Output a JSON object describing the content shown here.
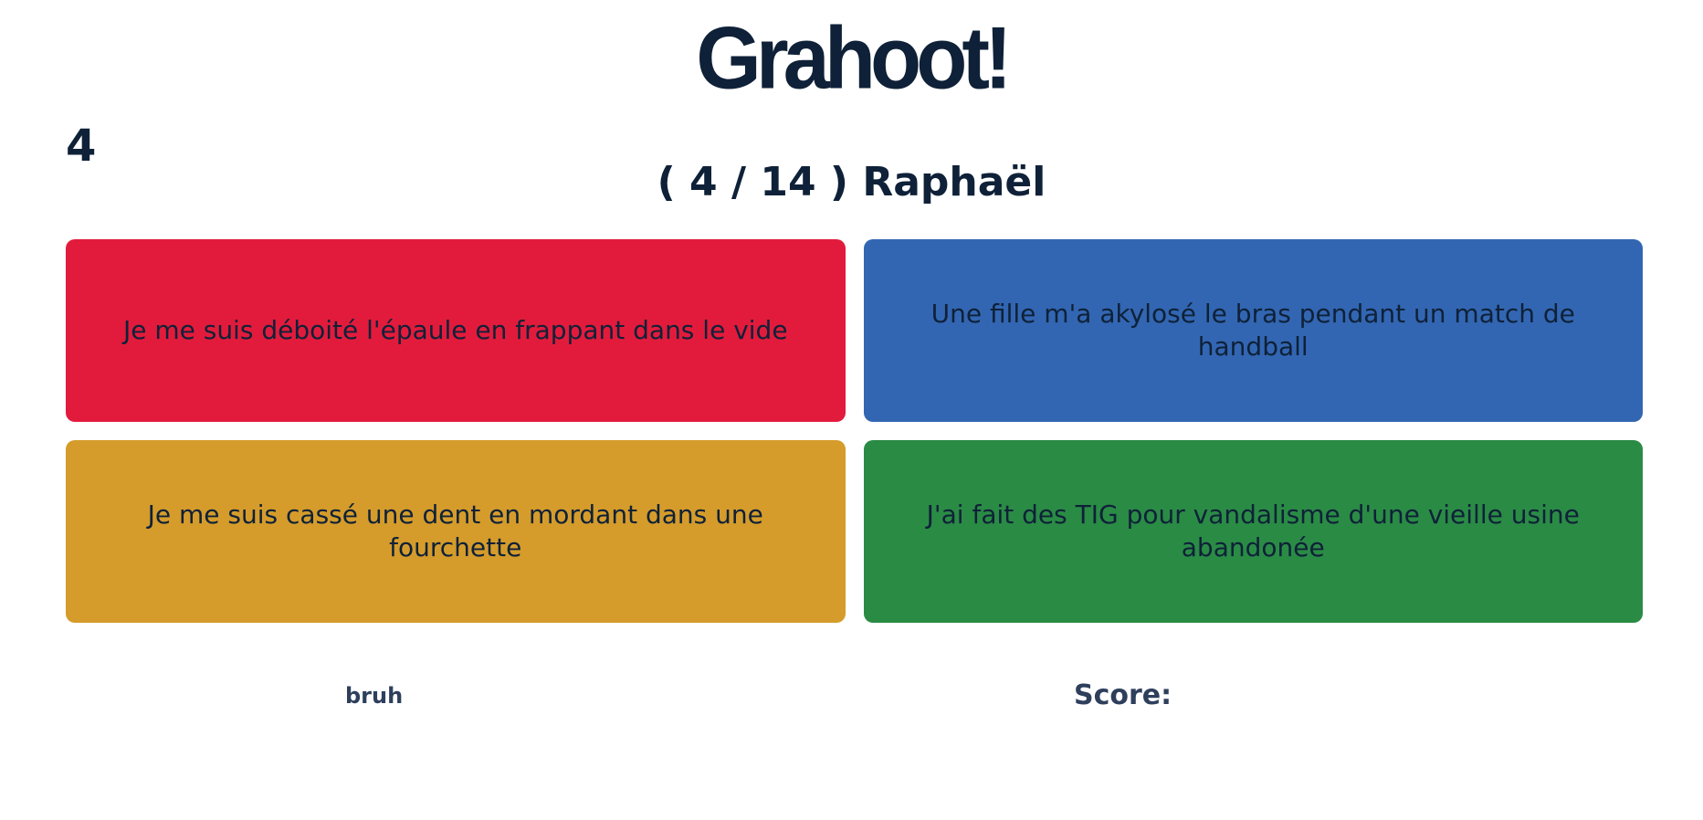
{
  "header": {
    "logo_text": "Grahoot!"
  },
  "game": {
    "timer": "4",
    "question": "( 4 / 14 ) Raphaël"
  },
  "answers": [
    {
      "text": "Je me suis déboité l'épaule en frappant dans le vide",
      "color": "#e21b3c"
    },
    {
      "text": "Une fille m'a akylosé le bras pendant un match de handball",
      "color": "#3266b2"
    },
    {
      "text": "Je me suis cassé une dent en mordant dans une fourchette",
      "color": "#d59c2b"
    },
    {
      "text": "J'ai fait des TIG pour vandalisme d'une vieille usine abandonée",
      "color": "#2a8b45"
    }
  ],
  "footer": {
    "player_name": "bruh",
    "score_label": "Score:"
  }
}
